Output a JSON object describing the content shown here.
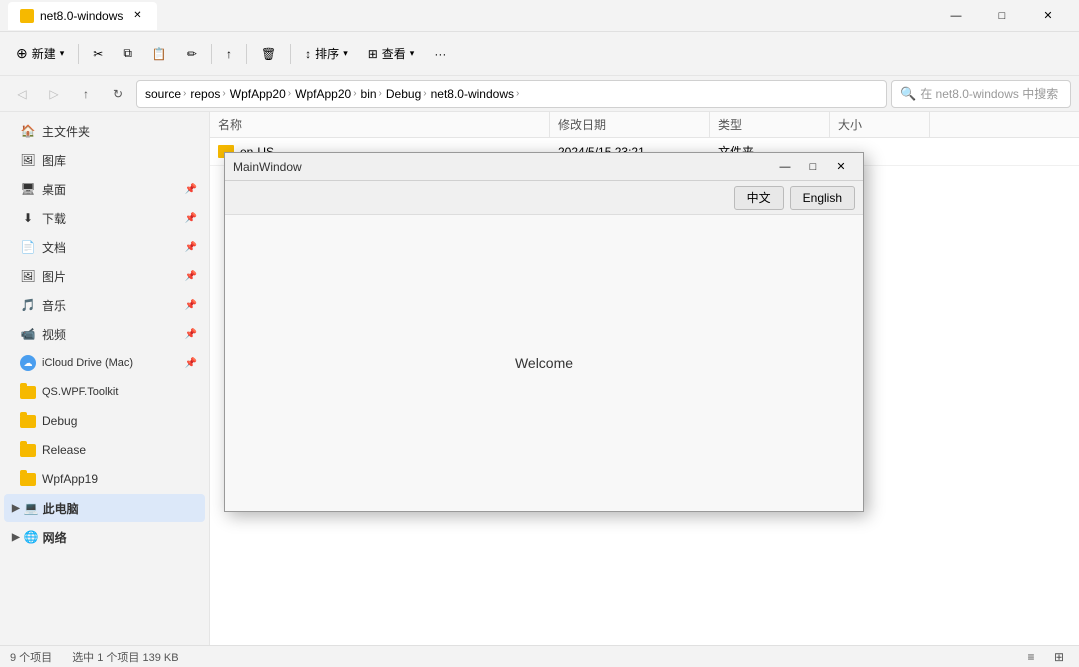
{
  "window": {
    "title": "net8.0-windows",
    "tab_label": "net8.0-windows"
  },
  "win_controls": {
    "minimize": "—",
    "maximize": "□",
    "close": "✕"
  },
  "toolbar": {
    "new_label": "新建",
    "cut_label": "",
    "copy_label": "",
    "paste_label": "",
    "rename_label": "",
    "delete_label": "",
    "sort_label": "排序",
    "view_label": "查看",
    "more_label": "···"
  },
  "address_bar": {
    "path_segments": [
      "source",
      "repos",
      "WpfApp20",
      "WpfApp20",
      "bin",
      "Debug",
      "net8.0-windows"
    ],
    "search_placeholder": "在 net8.0-windows 中搜索"
  },
  "sidebar": {
    "home_label": "主文件夹",
    "gallery_label": "图库",
    "desktop_label": "桌面",
    "downloads_label": "下载",
    "documents_label": "文档",
    "pictures_label": "图片",
    "music_label": "音乐",
    "videos_label": "视频",
    "icloud_label": "iCloud Drive (Mac)",
    "qs_wpf_label": "QS.WPF.Toolkit",
    "debug_label": "Debug",
    "release_label": "Release",
    "wpfapp_label": "WpfApp19",
    "this_pc_label": "此电脑",
    "network_label": "网络"
  },
  "file_list": {
    "headers": [
      "名称",
      "修改日期",
      "类型",
      "大小"
    ],
    "rows": [
      {
        "name": "en-US",
        "date": "2024/5/15 23:21",
        "type": "文件夹",
        "size": ""
      }
    ]
  },
  "status_bar": {
    "item_count": "9 个项目",
    "selected": "选中 1 个项目  139 KB"
  },
  "wpf_window": {
    "title": "MainWindow",
    "minimize": "—",
    "maximize": "□",
    "close": "✕",
    "lang_zh": "中文",
    "lang_en": "English",
    "welcome_text": "Welcome"
  }
}
